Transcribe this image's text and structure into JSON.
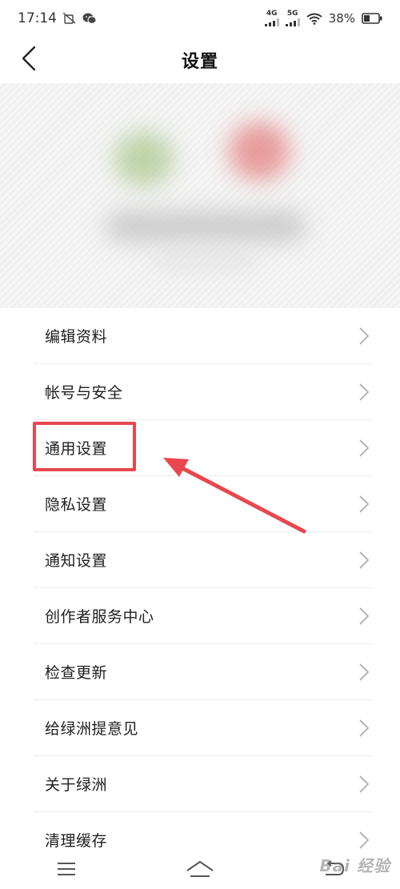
{
  "status_bar": {
    "time": "17:14",
    "net1": "4G",
    "net2": "5G",
    "battery": "38%",
    "icons": [
      "sim-disabled-icon",
      "wechat-icon",
      "signal-icon",
      "wifi-icon",
      "battery-icon"
    ]
  },
  "nav": {
    "title": "设置",
    "back_icon": "chevron-left-icon"
  },
  "menu": {
    "items": [
      {
        "label": "编辑资料"
      },
      {
        "label": "帐号与安全"
      },
      {
        "label": "通用设置"
      },
      {
        "label": "隐私设置"
      },
      {
        "label": "通知设置"
      },
      {
        "label": "创作者服务中心"
      },
      {
        "label": "检查更新"
      },
      {
        "label": "给绿洲提意见"
      },
      {
        "label": "关于绿洲"
      },
      {
        "label": "清理缓存"
      }
    ]
  },
  "annotation": {
    "highlighted_item": "通用设置",
    "color": "#e8474f"
  },
  "bottom_nav": {
    "icons": [
      "menu-icon",
      "home-icon",
      "back-icon"
    ]
  },
  "watermark": "Bai 经验"
}
